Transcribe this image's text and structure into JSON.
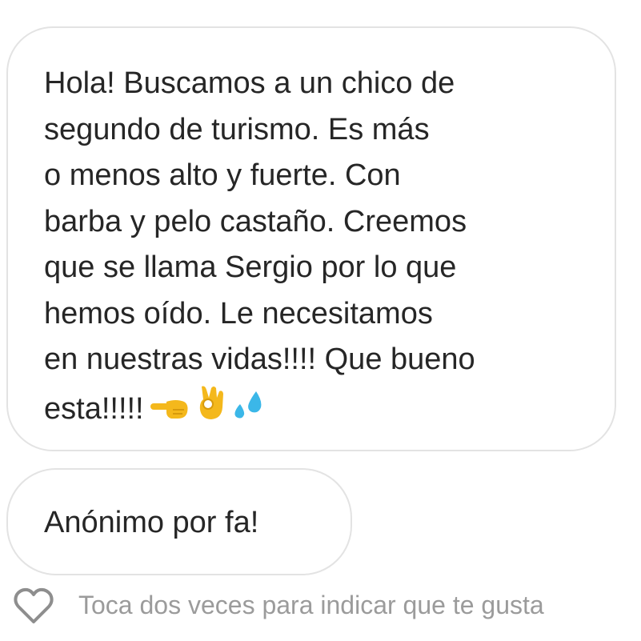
{
  "messages": [
    {
      "lines": [
        "Hola! Buscamos a un chico de",
        "segundo de turismo. Es más",
        "o menos alto y fuerte. Con",
        "barba y pelo castaño. Creemos",
        "que se llama Sergio por lo que",
        "hemos oído. Le necesitamos",
        "en nuestras vidas!!!! Que bueno",
        "esta!!!!!"
      ],
      "emojis": [
        "backhand-index-pointing-left-emoji",
        "ok-hand-emoji",
        "sweat-droplets-emoji"
      ]
    },
    {
      "text": "Anónimo por fa!"
    }
  ],
  "like": {
    "icon": "heart-outline-icon",
    "hint": "Toca dos veces para indicar que te gusta"
  },
  "colors": {
    "bubble_border": "#e3e3e3",
    "text": "#262626",
    "hint": "#9b9b9b",
    "emoji_yellow": "#f4b81c",
    "emoji_blue": "#3bb7e8"
  }
}
